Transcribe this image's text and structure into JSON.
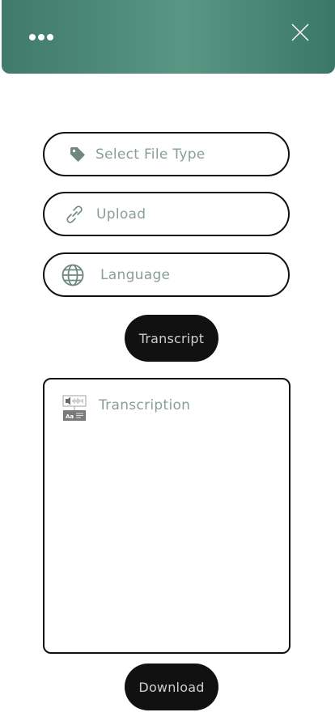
{
  "colors": {
    "header_gradient_start": "#3f7a6a",
    "header_gradient_mid": "#5a9684",
    "button_dark": "#111111",
    "placeholder_text": "#8a9e98"
  },
  "header": {
    "menu_icon": "more-horizontal-icon",
    "close_icon": "close-icon"
  },
  "form": {
    "file_type": {
      "label": "Select File Type",
      "icon": "tag-icon"
    },
    "upload": {
      "label": "Upload",
      "icon": "link-icon"
    },
    "language": {
      "label": "Language",
      "icon": "globe-icon"
    },
    "transcript_button": "Transcript"
  },
  "output": {
    "label": "Transcription",
    "icon": "audio-to-text-icon"
  },
  "download_button": "Download"
}
